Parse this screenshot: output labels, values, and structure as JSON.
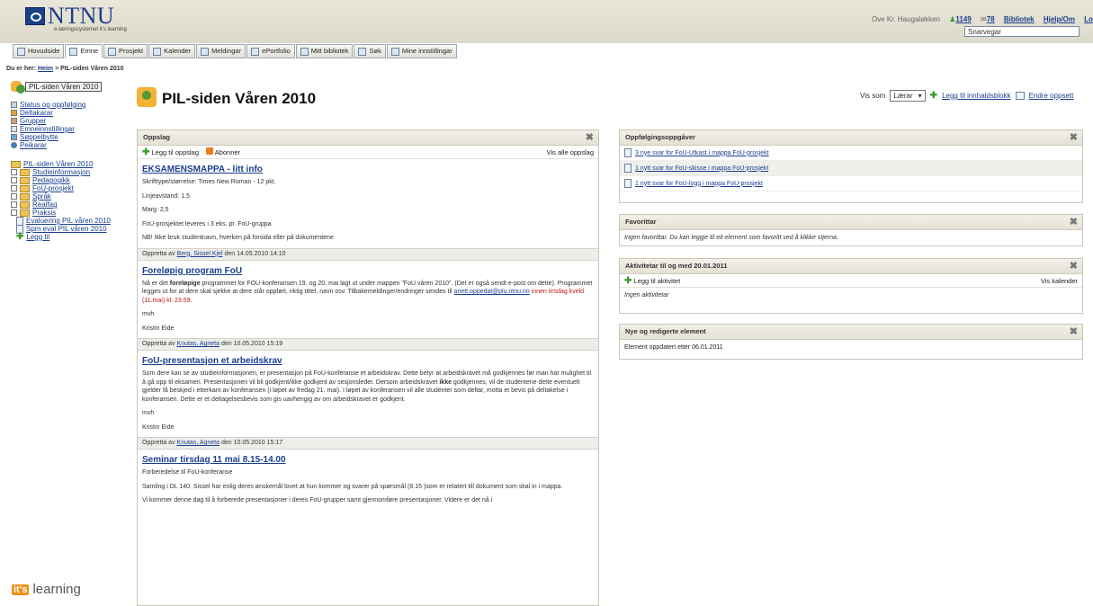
{
  "header": {
    "logo_text": "NTNU",
    "logo_sub": "e-læringssystemet it's learning",
    "user_name": "Ove Kr. Haugaløkken",
    "count_a": "1149",
    "count_b": "78",
    "links": [
      "Bibliotek",
      "Hjelp/Om",
      "Lo"
    ],
    "shortcut": "Snarvegar"
  },
  "nav": {
    "tabs": [
      {
        "label": "Hovudside",
        "icon": "home-icon"
      },
      {
        "label": "Emne",
        "icon": "course-icon",
        "active": true
      },
      {
        "label": "Prosjekt",
        "icon": "project-icon"
      },
      {
        "label": "Kalender",
        "icon": "calendar-icon"
      },
      {
        "label": "Meldingar",
        "icon": "mail-icon"
      },
      {
        "label": "ePortfolio",
        "icon": "portfolio-icon"
      },
      {
        "label": "Mitt bibliotek",
        "icon": "library-icon"
      },
      {
        "label": "Søk",
        "icon": "search-icon"
      },
      {
        "label": "Mine innstillingar",
        "icon": "settings-icon"
      }
    ]
  },
  "breadcrumb": {
    "prefix": "Du er her:",
    "home": "Heim",
    "current": "> PIL-siden Våren 2010"
  },
  "sidebar": {
    "course_button": "PIL-siden Våren 2010",
    "tools": [
      "Status og oppfølging",
      "Deltakarar",
      "Grupper",
      "Emneinnstillingar",
      "Søppelbytte",
      "Peikarar"
    ],
    "tree_root": "PIL-siden Våren 2010",
    "folders": [
      "Studieinformasjon",
      "Pedagogikk",
      "FoU-prosjekt",
      "Språk",
      "Realfag",
      "Praksis"
    ],
    "files": [
      "Evaluering PIL våren 2010",
      "Spm eval PIL våren 2010"
    ],
    "add": "Legg til"
  },
  "main": {
    "title": "PIL-siden Våren 2010",
    "view_as": "Vis som",
    "role": "Lærar",
    "add_block": "Legg til innhaldsblokk",
    "edit_layout": "Endre oppsett"
  },
  "posts_panel": {
    "title": "Oppslag",
    "add": "Legg til oppslag",
    "subscribe": "Abonner",
    "show_all": "Vis alle oppslag",
    "posts": [
      {
        "title": "EKSAMENSMAPPA - litt info",
        "lines": [
          "Skrifttype/størrelse:  Times New Roman - 12 pkt.",
          "Linjeavstand:  1,5",
          "Marg:  2,5",
          "FoU-prosjektet leveres i 3 eks. pr. FoU-gruppa",
          "NB! Ikke bruk studentnavn, hverken på forsida eller på dokumentene"
        ],
        "meta_pre": "Oppretta av",
        "author": "Berg, Sissel Kjel",
        "meta_date": "den 14.05.2010 14:10"
      },
      {
        "title": "Foreløpig program FoU",
        "p1_a": "Nå er det ",
        "p1_b": "foreløpige",
        "p1_c": " programmet for FOU-konferansen 19. og 20. mai lagt ut under mappen \"FoU våren 2010\". (Det er også sendt e-post om dette). Programmet legges ut for at dere skal sjekke at dere står oppført, riktig tittel, navn osv. Tilbakemeldinger/endringer sendes til ",
        "email": "anett.oppedal@plu.ntnu.no",
        "deadline": " innen tirsdag kveld (11.mai) kl. 23:59.",
        "sign1": "mvh",
        "sign2": "Kristin Eide",
        "meta_pre": "Oppretta av",
        "author": "Knutas, Agneta",
        "meta_date": "den 10.05.2010 15:19"
      },
      {
        "title": "FoU-presentasjon et arbeidskrav",
        "p1_a": "Som dere kan se av studieinformasjonen, er presentasjon på FoU-konferanse et arbeidskrav. Dette betyr at arbeidskravet må godkjennes før man har mulighet til å gå opp til eksamen. Presentasjonen vil bli godkjent/ikke godkjent av sesjonsleder. Dersom arbeidskravet ",
        "p1_b": "ikke",
        "p1_c": " godkjennes, vil de studentene dette eventuelt gjelder få beskjed i etterkant av konferansen (i løpet av fredag 21. mai). I løpet av konferansen vil alle studenter som deltar, motta et bevis på deltakelse i konferansen. Dette er et deltagelsesbevis som gis uavhengig av om arbeidskravet er godkjent.",
        "sign1": "mvh",
        "sign2": "Kristin Eide",
        "meta_pre": "Oppretta av",
        "author": "Knutas, Agneta",
        "meta_date": "den 10.05.2010 15:17"
      },
      {
        "title": "Seminar tirsdag 11 mai 8.15-14.00",
        "lines": [
          "Forberedelse til FoU-konferanse",
          "Samling i DL 140. Sissel har enlig deres ønskemål lovet at hun kommer og svarer på spørsmål (8.15 )som er relatert till dokument som skal in i mappa.",
          "Vi kommer denne dag til å forberede presentasjoner i deres FoU-grupper samt gjennomføre presentasjoner. Videre er det nå i"
        ]
      }
    ]
  },
  "tasks_panel": {
    "title": "Oppfølgingsoppgåver",
    "items": [
      "3 nye svar for FoU-Utkast i mappa FoU-prosjekt",
      "1 nytt svar for FoU-skisse i mappa FoU-prosjekt",
      "1 nytt svar for FoU-logg i mappa FoU-prosjekt"
    ]
  },
  "favorites_panel": {
    "title": "Favorittar",
    "empty": "Ingen favorittar. Du kan leggje til eit element som favoritt ved å klikke stjerna."
  },
  "activity_panel": {
    "title": "Aktivitetar til og med 20.01.2011",
    "add": "Legg til aktivitet",
    "calendar": "Vis kalender",
    "empty": "Ingen aktivitetar"
  },
  "new_panel": {
    "title": "Nye og redigerte element",
    "text": "Element oppdatert etter 06.01.2011"
  },
  "footer": {
    "logo_mark": "it's",
    "logo_word": "learning"
  }
}
